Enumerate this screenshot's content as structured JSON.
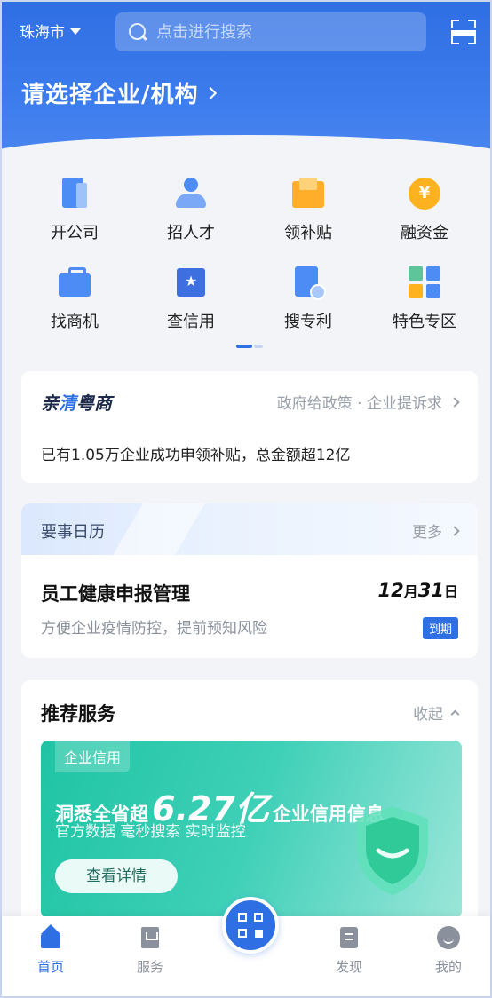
{
  "header": {
    "city": "珠海市",
    "search_placeholder": "点击进行搜索",
    "org_prompt": "请选择企业/机构"
  },
  "quick_actions": [
    {
      "label": "开公司",
      "icon": "document-icon"
    },
    {
      "label": "招人才",
      "icon": "person-icon"
    },
    {
      "label": "领补贴",
      "icon": "subsidy-box-icon"
    },
    {
      "label": "融资金",
      "icon": "yuan-coin-icon"
    },
    {
      "label": "找商机",
      "icon": "briefcase-icon"
    },
    {
      "label": "查信用",
      "icon": "star-certificate-icon"
    },
    {
      "label": "搜专利",
      "icon": "patent-search-icon"
    },
    {
      "label": "特色专区",
      "icon": "tiles-icon"
    }
  ],
  "qinqing": {
    "title_part1": "亲",
    "title_highlight": "清",
    "title_part2": "粤商",
    "link_text": "政府给政策 · 企业提诉求",
    "description": "已有1.05万企业成功申领补贴，总金额超12亿"
  },
  "calendar": {
    "title": "要事日历",
    "more": "更多",
    "item_title": "员工健康申报管理",
    "date_month": "12",
    "month_unit": "月",
    "date_day": "31",
    "day_unit": "日",
    "item_desc": "方便企业疫情防控，提前预知风险",
    "badge": "到期"
  },
  "recommend": {
    "title": "推荐服务",
    "collapse": "收起",
    "banner": {
      "tag": "企业信用",
      "head_prefix": "洞悉全省超",
      "head_number": "6.27亿",
      "head_suffix": "企业信用信息",
      "subtitle": "官方数据 毫秒搜索 实时监控",
      "button": "查看详情"
    }
  },
  "bottom_nav": {
    "home": "首页",
    "service": "服务",
    "discover": "发现",
    "me": "我的"
  },
  "colors": {
    "primary": "#2f6fe4",
    "banner_green": "#1fc4a4",
    "warning_orange": "#ffb21f"
  }
}
